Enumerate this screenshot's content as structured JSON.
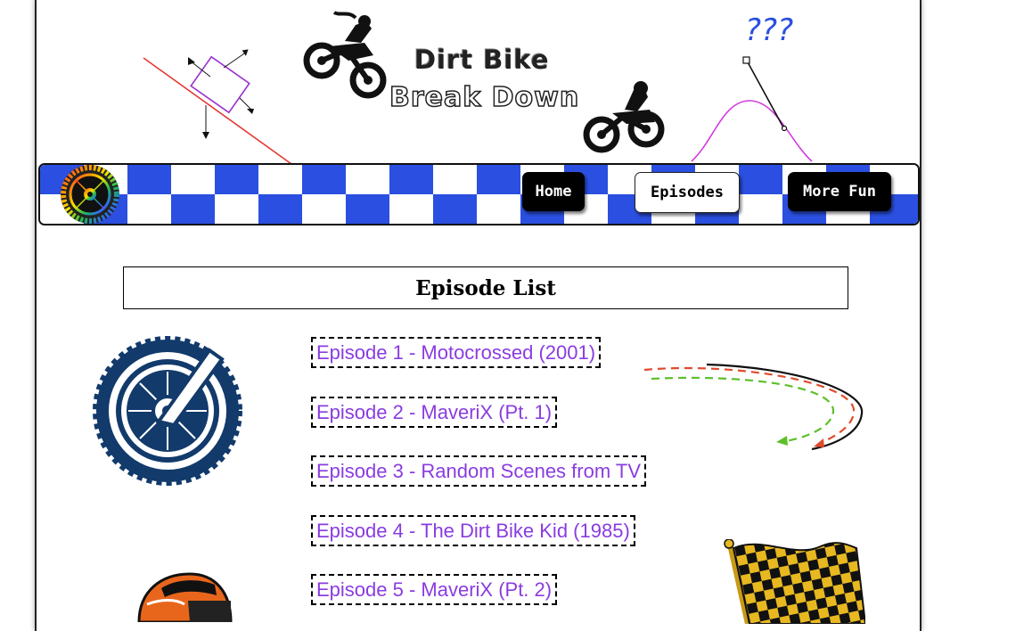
{
  "header": {
    "logo_line1": "Dirt Bike",
    "logo_line2": "Break Down",
    "question_marks": "???"
  },
  "nav": {
    "items": [
      {
        "label": "Home",
        "style": "dark"
      },
      {
        "label": "Episodes",
        "style": "light"
      },
      {
        "label": "More Fun",
        "style": "dark"
      }
    ]
  },
  "main": {
    "heading": "Episode List",
    "episodes": [
      {
        "label": "Episode 1 - Motocrossed (2001)"
      },
      {
        "label": "Episode 2 - MaveriX (Pt. 1)"
      },
      {
        "label": "Episode 3 - Random Scenes from TV"
      },
      {
        "label": "Episode 4 - The Dirt Bike Kid (1985)"
      },
      {
        "label": "Episode 5 - MaveriX (Pt. 2)"
      }
    ]
  },
  "colors": {
    "checker_blue": "#2b4fe0",
    "link_purple": "#8a3ce0"
  }
}
